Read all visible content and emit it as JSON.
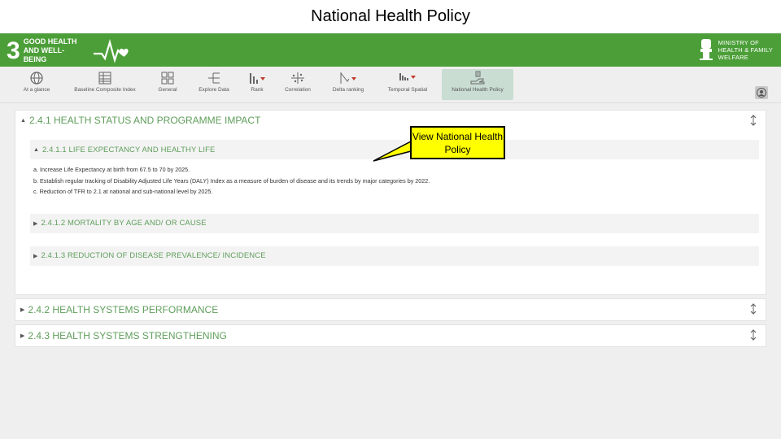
{
  "slide": {
    "title": "National Health Policy"
  },
  "banner": {
    "goal_number": "3",
    "goal_text": "GOOD HEALTH AND WELL-BEING",
    "ministry_text": [
      "MINISTRY OF",
      "HEALTH & FAMILY",
      "WELFARE"
    ],
    "color": "#4c9f38"
  },
  "toolbar": {
    "items": [
      {
        "label": "At a glance",
        "icon": "globe-icon"
      },
      {
        "label": "Baseline Composite Index",
        "icon": "table-icon"
      },
      {
        "label": "General",
        "icon": "grid-icon"
      },
      {
        "label": "Explore Data",
        "icon": "tree-icon"
      },
      {
        "label": "Rank",
        "icon": "rank-icon"
      },
      {
        "label": "Correlation",
        "icon": "scatter-icon"
      },
      {
        "label": "Delta ranking",
        "icon": "delta-icon"
      },
      {
        "label": "Temporal Spatial",
        "icon": "bars-icon"
      },
      {
        "label": "National Health Policy",
        "icon": "hand-icon",
        "active": true
      }
    ]
  },
  "sections": {
    "s1": {
      "title": "2.4.1 HEALTH STATUS AND PROGRAMME IMPACT"
    },
    "s1_1": {
      "title": "2.4.1.1 LIFE EXPECTANCY AND HEALTHY LIFE"
    },
    "s1_1_lines": [
      "a. Increase Life Expectancy at birth from 67.5 to 70 by 2025.",
      "b. Establish regular tracking of Disability Adjusted Life Years (DALY) Index as a measure of burden of disease and its trends by major categories by 2022.",
      "c. Reduction of TFR to 2.1 at national and sub-national level by 2025."
    ],
    "s1_2": {
      "title": "2.4.1.2 MORTALITY BY AGE AND/ OR CAUSE"
    },
    "s1_3": {
      "title": "2.4.1.3 REDUCTION OF DISEASE PREVALENCE/ INCIDENCE"
    },
    "s2": {
      "title": "2.4.2 HEALTH SYSTEMS PERFORMANCE"
    },
    "s3": {
      "title": "2.4.3 HEALTH SYSTEMS STRENGTHENING"
    }
  },
  "callout": {
    "text": "View National Health Policy"
  },
  "colors": {
    "section_text": "#5f9e5b",
    "callout_bg": "#ffff00"
  }
}
